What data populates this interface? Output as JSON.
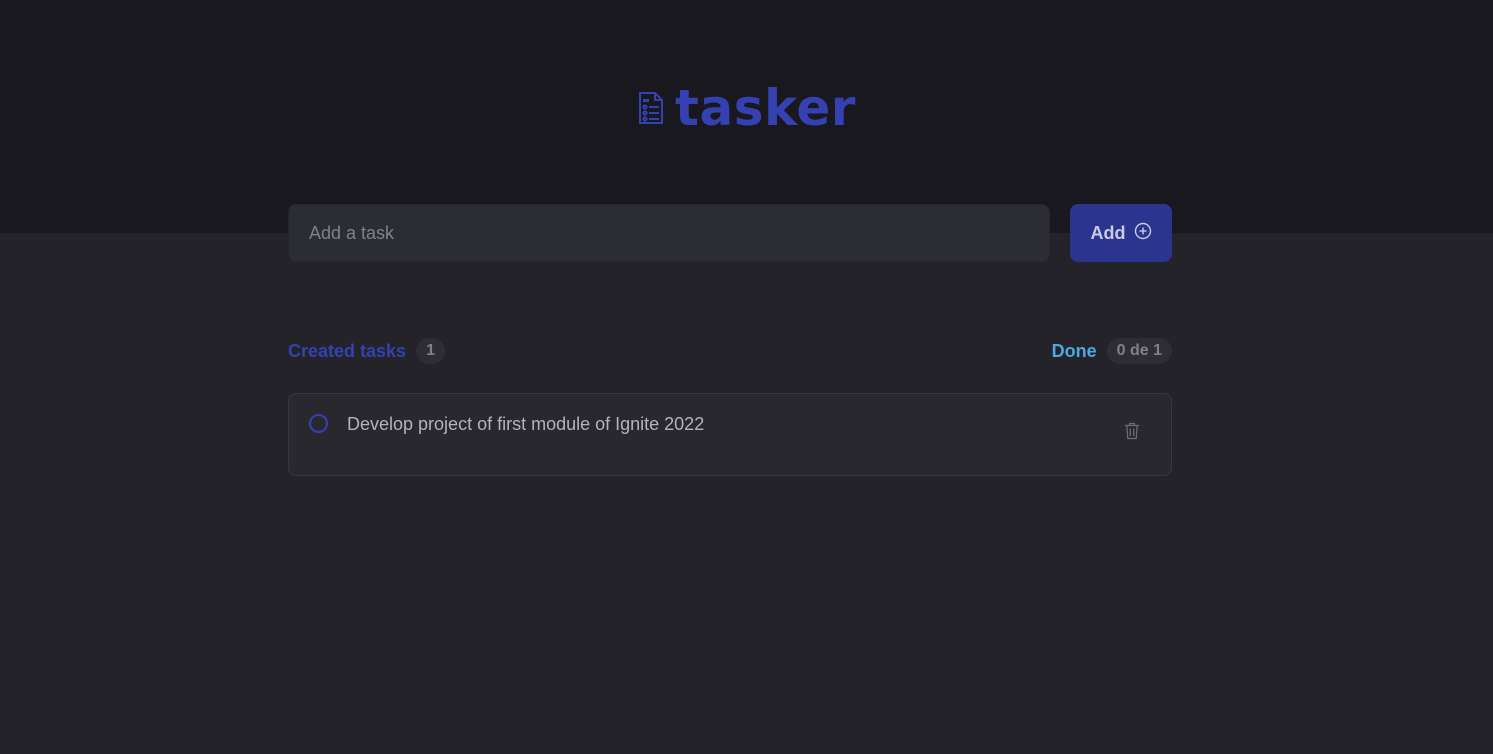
{
  "app": {
    "title": "tasker",
    "accent_color": "#3541b0",
    "done_color": "#4ea8de",
    "logo_icon": "clipboard-list-icon"
  },
  "new_task": {
    "placeholder": "Add a task",
    "value": "",
    "add_label": "Add",
    "add_icon": "plus-circle-icon"
  },
  "summary": {
    "created_label": "Created tasks",
    "created_count": "1",
    "done_label": "Done",
    "done_count": "0 de 1"
  },
  "tasks": [
    {
      "text": "Develop project of first module of Ignite 2022",
      "done": false,
      "delete_icon": "trash-icon"
    }
  ]
}
